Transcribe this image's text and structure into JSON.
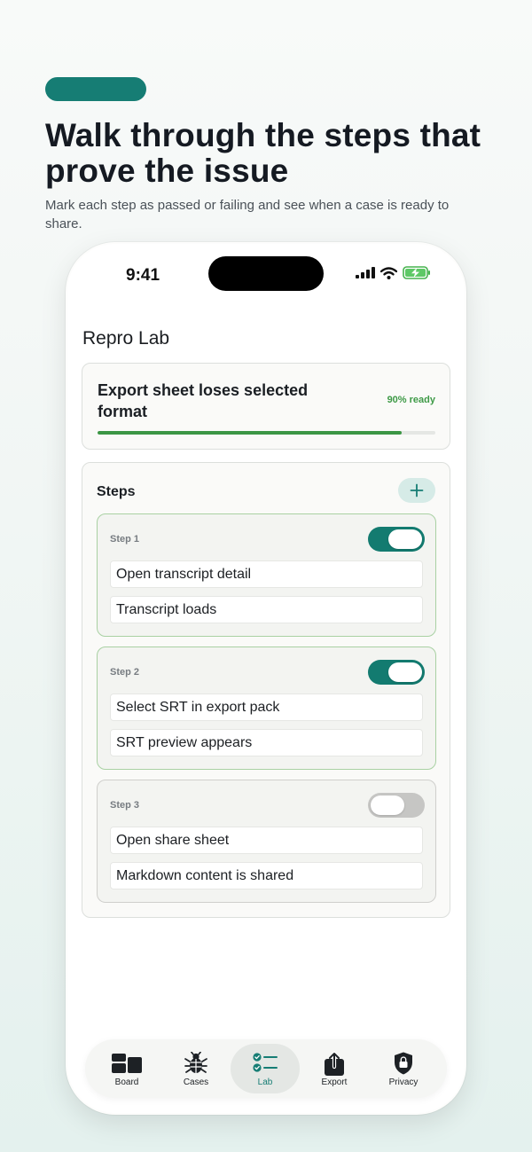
{
  "promo": {
    "headline": "Walk through the steps that prove the issue",
    "subline": "Mark each step as passed or failing and see when a case is ready to share."
  },
  "status_bar": {
    "time": "9:41"
  },
  "app": {
    "title": "Repro Lab"
  },
  "case": {
    "title": "Export sheet loses selected format",
    "ready_label": "90% ready",
    "ready_fraction": 0.9
  },
  "steps_section": {
    "heading": "Steps",
    "add_icon": "plus-icon"
  },
  "steps": [
    {
      "label": "Step 1",
      "enabled": true,
      "action": "Open transcript detail",
      "expected": "Transcript loads"
    },
    {
      "label": "Step 2",
      "enabled": true,
      "action": "Select SRT in export pack",
      "expected": "SRT preview appears"
    },
    {
      "label": "Step 3",
      "enabled": false,
      "action": "Open share sheet",
      "expected": "Markdown content is shared"
    }
  ],
  "tabs": [
    {
      "label": "Board",
      "icon": "board-icon",
      "active": false
    },
    {
      "label": "Cases",
      "icon": "bug-icon",
      "active": false
    },
    {
      "label": "Lab",
      "icon": "checklist-icon",
      "active": true
    },
    {
      "label": "Export",
      "icon": "share-icon",
      "active": false
    },
    {
      "label": "Privacy",
      "icon": "lock-shield-icon",
      "active": false
    }
  ],
  "colors": {
    "accent": "#167d74",
    "progress": "#3b9644",
    "ready_text": "#3e9a47",
    "toggle_off": "#c6c6c4"
  }
}
